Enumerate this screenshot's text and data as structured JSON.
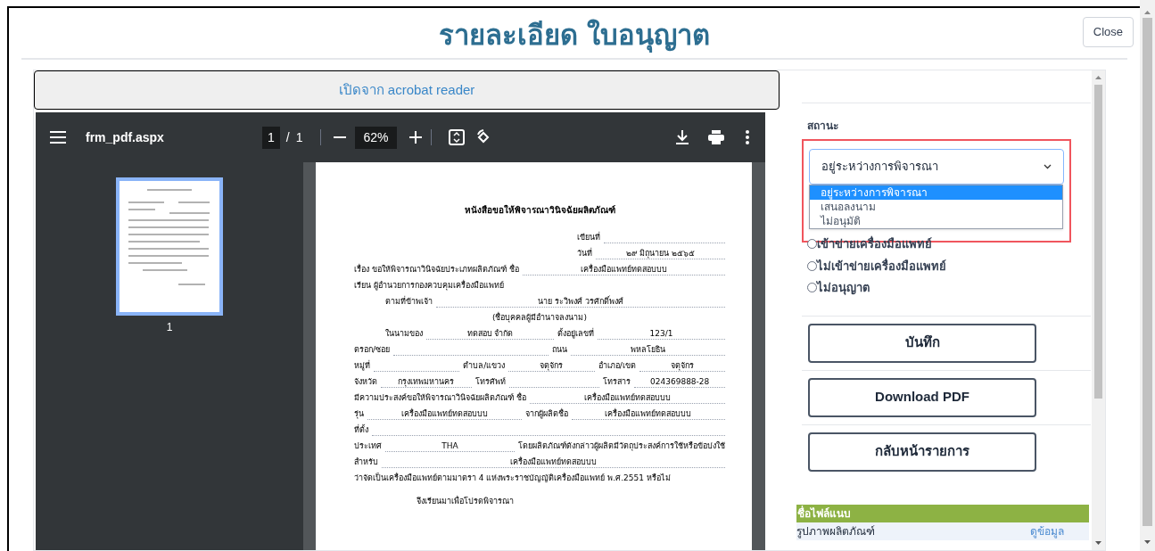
{
  "title": "รายละเอียด ใบอนุญาต",
  "close_button": "Close",
  "open_button": "เปิดจาก acrobat reader",
  "pdf_viewer": {
    "file_name": "frm_pdf.aspx",
    "page_input": "1",
    "page_separator": "/",
    "page_total": "1",
    "zoom": "62%",
    "thumbnail_label": "1",
    "document": {
      "heading": "หนังสือขอให้พิจารณาวินิจฉัยผลิตภัณฑ์",
      "rows": [
        {
          "kind": "right",
          "segments": [
            {
              "kind": "label",
              "text": "เขียนที่"
            },
            {
              "kind": "blank"
            }
          ]
        },
        {
          "kind": "right",
          "segments": [
            {
              "kind": "label",
              "text": "วันที่"
            },
            {
              "kind": "value",
              "text": "๒๙ มิถุนายน ๒๕๖๕"
            }
          ]
        },
        {
          "kind": "left",
          "segments": [
            {
              "kind": "label",
              "text": "เรื่อง ขอให้พิจารณาวินิจฉัยประเภทผลิตภัณฑ์ ชื่อ"
            },
            {
              "kind": "value",
              "text": "เครื่องมือแพทย์ทดสอบบบ"
            }
          ]
        },
        {
          "kind": "left",
          "segments": [
            {
              "kind": "label",
              "text": "เรียน ผู้อำนวยการกองควบคุมเครื่องมือแพทย์"
            }
          ]
        },
        {
          "kind": "indent",
          "segments": [
            {
              "kind": "label",
              "text": "ตามที่ข้าพเจ้า"
            },
            {
              "kind": "value",
              "text": "นาย ระวิพงศ์ วรศักดิ์พงศ์"
            }
          ]
        },
        {
          "kind": "center",
          "segments": [
            {
              "kind": "label",
              "text": "(ชื่อบุคคลผู้มีอำนาจลงนาม)"
            }
          ]
        },
        {
          "kind": "indent",
          "segments": [
            {
              "kind": "label",
              "text": "ในนามของ"
            },
            {
              "kind": "value",
              "text": "ทดสอบ จำกัด"
            },
            {
              "kind": "label",
              "text": "ตั้งอยู่เลขที่"
            },
            {
              "kind": "value",
              "text": "123/1"
            }
          ]
        },
        {
          "kind": "left",
          "segments": [
            {
              "kind": "label",
              "text": "ตรอก/ซอย"
            },
            {
              "kind": "blank"
            },
            {
              "kind": "label",
              "text": "ถนน"
            },
            {
              "kind": "value",
              "text": "พหลโยธิน"
            }
          ]
        },
        {
          "kind": "left",
          "segments": [
            {
              "kind": "label",
              "text": "หมู่ที่"
            },
            {
              "kind": "blank"
            },
            {
              "kind": "label",
              "text": "ตำบล/แขวง"
            },
            {
              "kind": "value",
              "text": "จตุจักร"
            },
            {
              "kind": "label",
              "text": "อำเภอ/เขต"
            },
            {
              "kind": "value",
              "text": "จตุจักร"
            }
          ]
        },
        {
          "kind": "left",
          "segments": [
            {
              "kind": "label",
              "text": "จังหวัด"
            },
            {
              "kind": "value",
              "text": "กรุงเทพมหานคร"
            },
            {
              "kind": "label",
              "text": "โทรศัพท์"
            },
            {
              "kind": "blank"
            },
            {
              "kind": "label",
              "text": "โทรสาร"
            },
            {
              "kind": "value",
              "text": "024369888-28"
            }
          ]
        },
        {
          "kind": "left",
          "segments": [
            {
              "kind": "label",
              "text": "มีความประสงค์ขอให้พิจารณาวินิจฉัยผลิตภัณฑ์  ชื่อ"
            },
            {
              "kind": "value",
              "text": "เครื่องมือแพทย์ทดสอบบบ"
            }
          ]
        },
        {
          "kind": "left",
          "segments": [
            {
              "kind": "label",
              "text": "รุ่น"
            },
            {
              "kind": "value",
              "text": "เครื่องมือแพทย์ทดสอบบบ"
            },
            {
              "kind": "label",
              "text": "จากผู้ผลิตชื่อ"
            },
            {
              "kind": "value",
              "text": "เครื่องมือแพทย์ทดสอบบบ"
            }
          ]
        },
        {
          "kind": "left",
          "segments": [
            {
              "kind": "label",
              "text": "ที่ตั้ง"
            },
            {
              "kind": "blank"
            }
          ]
        },
        {
          "kind": "left",
          "segments": [
            {
              "kind": "label",
              "text": "ประเทศ"
            },
            {
              "kind": "value",
              "text": "THA"
            },
            {
              "kind": "label",
              "text": "โดยผลิตภัณฑ์ดังกล่าวผู้ผลิตมีวัตถุประสงค์การใช้หรือข้อบ่งใช้"
            }
          ]
        },
        {
          "kind": "left",
          "segments": [
            {
              "kind": "label",
              "text": "สำหรับ"
            },
            {
              "kind": "value",
              "text": "เครื่องมือแพทย์ทดสอบบบ"
            }
          ]
        },
        {
          "kind": "left",
          "segments": [
            {
              "kind": "label",
              "text": "ว่าจัดเป็นเครื่องมือแพทย์ตามมาตรา 4 แห่งพระราชบัญญัติเครื่องมือแพทย์ พ.ศ.2551 หรือไม่"
            }
          ]
        },
        {
          "kind": "closing",
          "segments": [
            {
              "kind": "label",
              "text": "จึงเรียนมาเพื่อโปรดพิจารณา"
            }
          ]
        }
      ]
    }
  },
  "status": {
    "label": "สถานะ",
    "value": "อยู่ระหว่างการพิจารณา",
    "options": [
      {
        "text": "อยู่ระหว่างการพิจารณา",
        "selected": true
      },
      {
        "text": "เสนอลงนาม",
        "selected": false
      },
      {
        "text": "ไม่อนุมัติ",
        "selected": false
      }
    ]
  },
  "decisions": [
    {
      "text": "เข้าข่ายเครื่องมือแพทย์",
      "selected": false
    },
    {
      "text": "ไม่เข้าข่ายเครื่องมือแพทย์",
      "selected": false
    },
    {
      "text": "ไม่อนุญาต",
      "selected": false
    }
  ],
  "actions": [
    "บันทึก",
    "Download PDF",
    "กลับหน้ารายการ"
  ],
  "attachments": {
    "header": "ชื่อไฟล์แนบ",
    "rows": [
      {
        "name": "รูปภาพผลิตภัณฑ์",
        "link": "ดูข้อมูล"
      }
    ]
  }
}
